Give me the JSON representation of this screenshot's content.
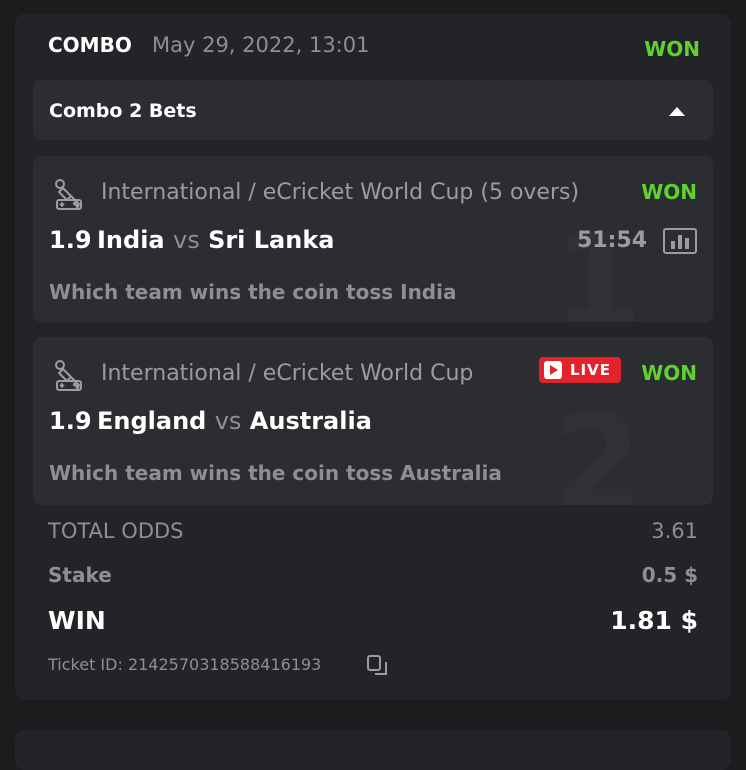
{
  "header": {
    "type": "COMBO",
    "date": "May 29, 2022, 13:01",
    "status": "WON"
  },
  "combo_bar": {
    "label": "Combo 2 Bets"
  },
  "bets": [
    {
      "index": "1",
      "league": "International / eCricket World Cup (5 overs)",
      "status": "WON",
      "odds": "1.9",
      "team_home": "India",
      "vs": "vs",
      "team_away": "Sri Lanka",
      "timer": "51:54",
      "market": "Which team wins the coin toss India",
      "icon": "cricket-icon"
    },
    {
      "index": "2",
      "league": "International / eCricket World Cup",
      "live_label": "LIVE",
      "status": "WON",
      "odds": "1.9",
      "team_home": "England",
      "vs": "vs",
      "team_away": "Australia",
      "market": "Which team wins the coin toss Australia",
      "icon": "cricket-icon"
    }
  ],
  "summary": {
    "total_odds_label": "TOTAL ODDS",
    "total_odds_value": "3.61",
    "stake_label": "Stake",
    "stake_value": "0.5 $",
    "win_label": "WIN",
    "win_value": "1.81 $",
    "ticket_label": "Ticket ID: 2142570318588416193"
  },
  "colors": {
    "background": "#1b1c1e",
    "card": "#232427",
    "panel": "#2c2d31",
    "won": "#5fd130",
    "live": "#e3232b",
    "muted": "#8d8f93"
  }
}
